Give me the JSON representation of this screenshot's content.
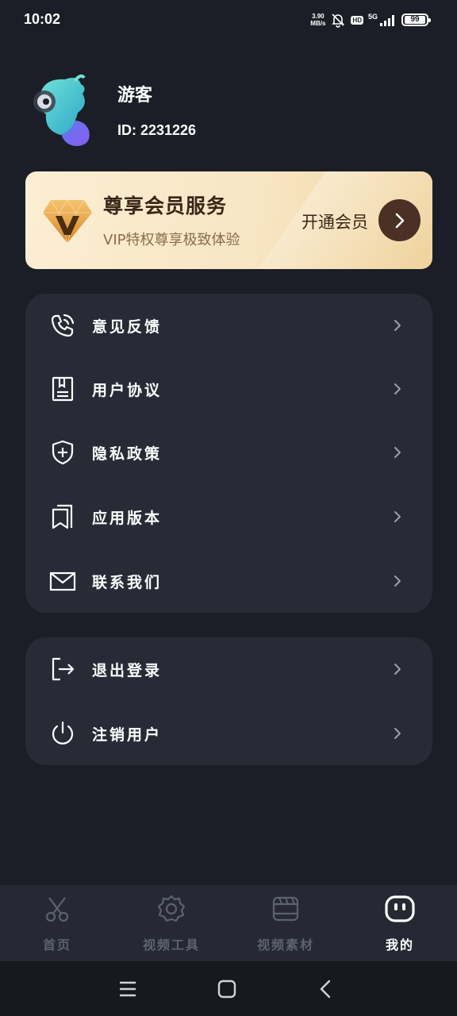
{
  "status_bar": {
    "time": "10:02",
    "net_speed_value": "3.90",
    "net_speed_unit": "MB/s",
    "hd_label": "HD",
    "network_type": "5G",
    "battery_level": "99",
    "icons": [
      "bell-muted-icon",
      "signal-icon",
      "battery-icon"
    ]
  },
  "profile": {
    "username": "游客",
    "user_id": "ID: 2231226",
    "avatar_icon": "mascot-avatar"
  },
  "vip": {
    "title": "尊享会员服务",
    "subtitle": "VIP特权尊享极致体验",
    "action_label": "开通会员",
    "icon": "vip-diamond-icon",
    "colors": {
      "card_start": "#fbeed3",
      "card_end": "#f0d49d",
      "button": "#4a3025"
    }
  },
  "menu": {
    "group1": [
      {
        "label": "意见反馈",
        "icon": "phone-call-icon"
      },
      {
        "label": "用户协议",
        "icon": "document-icon"
      },
      {
        "label": "隐私政策",
        "icon": "shield-plus-icon"
      },
      {
        "label": "应用版本",
        "icon": "bookmark-icon"
      },
      {
        "label": "联系我们",
        "icon": "mail-icon"
      }
    ],
    "group2": [
      {
        "label": "退出登录",
        "icon": "logout-icon"
      },
      {
        "label": "注销用户",
        "icon": "power-icon"
      }
    ]
  },
  "bottom_nav": {
    "tabs": [
      {
        "label": "首页",
        "icon": "scissors-icon",
        "active": false
      },
      {
        "label": "视频工具",
        "icon": "gear-icon",
        "active": false
      },
      {
        "label": "视频素材",
        "icon": "film-icon",
        "active": false
      },
      {
        "label": "我的",
        "icon": "smile-face-icon",
        "active": true
      }
    ],
    "colors": {
      "active": "#ffffff",
      "inactive": "#5d6170"
    }
  },
  "system_nav": {
    "buttons": [
      "menu-icon",
      "home-icon",
      "back-icon"
    ]
  },
  "theme": {
    "background": "#1b1e26",
    "card": "#282b36"
  }
}
